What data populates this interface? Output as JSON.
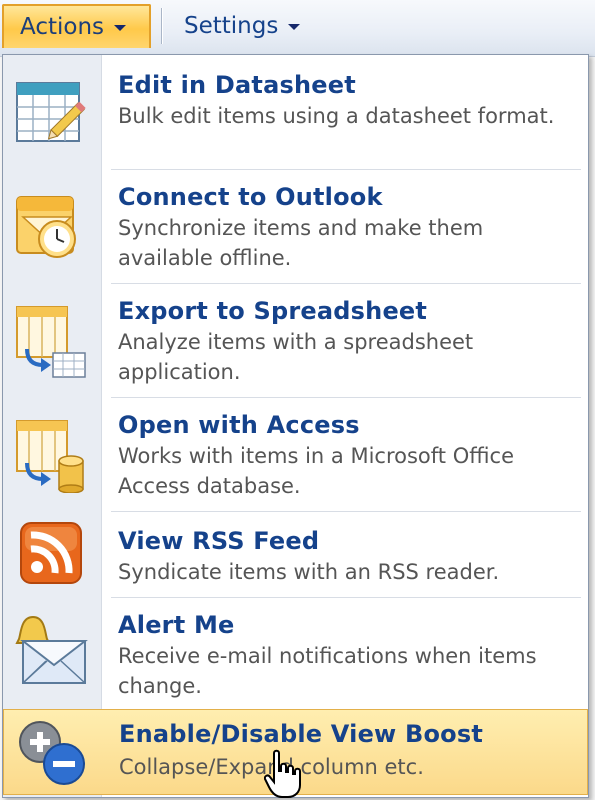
{
  "toolbar": {
    "actions_label": "Actions",
    "settings_label": "Settings"
  },
  "menu": {
    "items": [
      {
        "title": "Edit in Datasheet",
        "description": "Bulk edit items using a datasheet format.",
        "icon": "datasheet-pencil-icon"
      },
      {
        "title": "Connect to Outlook",
        "description": "Synchronize items and make them available offline.",
        "icon": "outlook-icon"
      },
      {
        "title": "Export to Spreadsheet",
        "description": "Analyze items with a spreadsheet application.",
        "icon": "export-spreadsheet-icon"
      },
      {
        "title": "Open with Access",
        "description": "Works with items in a Microsoft Office Access database.",
        "icon": "access-database-icon"
      },
      {
        "title": "View RSS Feed",
        "description": "Syndicate items with an RSS reader.",
        "icon": "rss-icon"
      },
      {
        "title": "Alert Me",
        "description": "Receive e-mail notifications when items change.",
        "icon": "alert-bell-envelope-icon"
      },
      {
        "title": "Enable/Disable View Boost",
        "description": "Collapse/Expand column etc.",
        "icon": "plus-minus-icon"
      }
    ]
  },
  "colors": {
    "accent_text": "#15428b",
    "hover_bg": "#fbd98a",
    "actions_button": "#ffc94a",
    "rss_orange": "#e8671c"
  }
}
